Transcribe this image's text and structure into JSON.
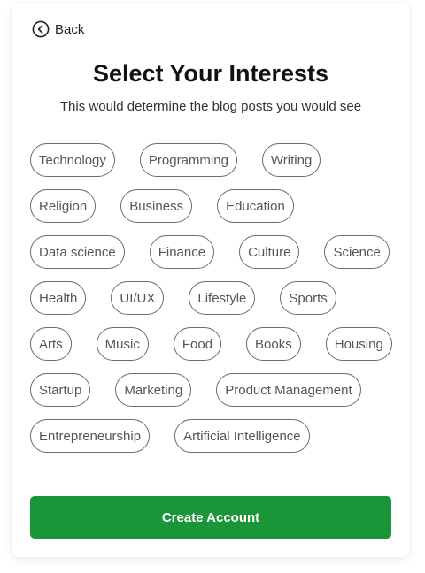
{
  "header": {
    "back_label": "Back",
    "back_icon": "arrow-left-circle-icon",
    "title": "Select Your Interests",
    "subtitle": "This would determine the blog posts you would see"
  },
  "interests": [
    "Technology",
    "Programming",
    "Writing",
    "Religion",
    "Business",
    "Education",
    "Data science",
    "Finance",
    "Culture",
    "Science",
    "Health",
    "UI/UX",
    "Lifestyle",
    "Sports",
    "Arts",
    "Music",
    "Food",
    "Books",
    "Housing",
    "Startup",
    "Marketing",
    "Product Management",
    "Entrepreneurship",
    "Artificial Intelligence"
  ],
  "actions": {
    "create_account_label": "Create Account"
  },
  "colors": {
    "accent": "#1a9638",
    "chip_border": "#6b6b6b",
    "chip_text": "#555555"
  }
}
